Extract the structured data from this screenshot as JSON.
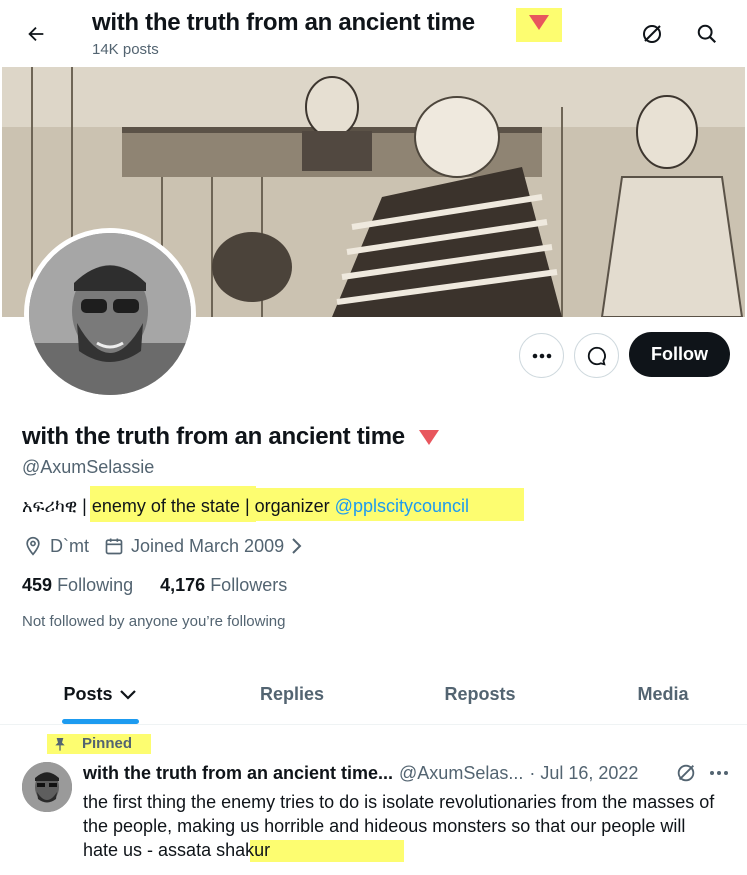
{
  "header": {
    "title": "with the truth from an ancient time",
    "posts_count": "14K posts"
  },
  "profile": {
    "name": "with the truth from an ancient time",
    "handle": "@AxumSelassie",
    "bio_prefix": "አፍሪካዊ | ",
    "bio_highlight": "enemy of the state",
    "bio_middle": " | organizer ",
    "bio_mention": "@pplscitycouncil",
    "location": "D`mt",
    "joined": "Joined March 2009",
    "following_count": "459",
    "following_label": "Following",
    "followers_count": "4,176",
    "followers_label": "Followers",
    "not_followed": "Not followed by anyone you’re following",
    "follow_label": "Follow"
  },
  "tabs": [
    {
      "label": "Posts"
    },
    {
      "label": "Replies"
    },
    {
      "label": "Reposts"
    },
    {
      "label": "Media"
    }
  ],
  "pinned_post": {
    "pinned_label": "Pinned",
    "author": "with the truth from an ancient time...",
    "handle": "@AxumSelas...",
    "date": "· Jul 16, 2022",
    "text_main": "the first thing the enemy tries to do is isolate revolutionaries from the masses of the people, making us horrible and hideous monsters so that our people will hate us ",
    "text_highlight": "- assata shakur"
  },
  "colors": {
    "highlight": "#fdfd70",
    "accent": "#1d9bf0",
    "triangle": "#e8565d",
    "follow_bg": "#0f1419"
  },
  "icons": [
    "back-arrow-icon",
    "no-grok-icon",
    "search-icon",
    "more-icon",
    "message-icon",
    "location-pin-icon",
    "calendar-icon",
    "chevron-right-icon",
    "chevron-down-icon",
    "pin-icon"
  ]
}
